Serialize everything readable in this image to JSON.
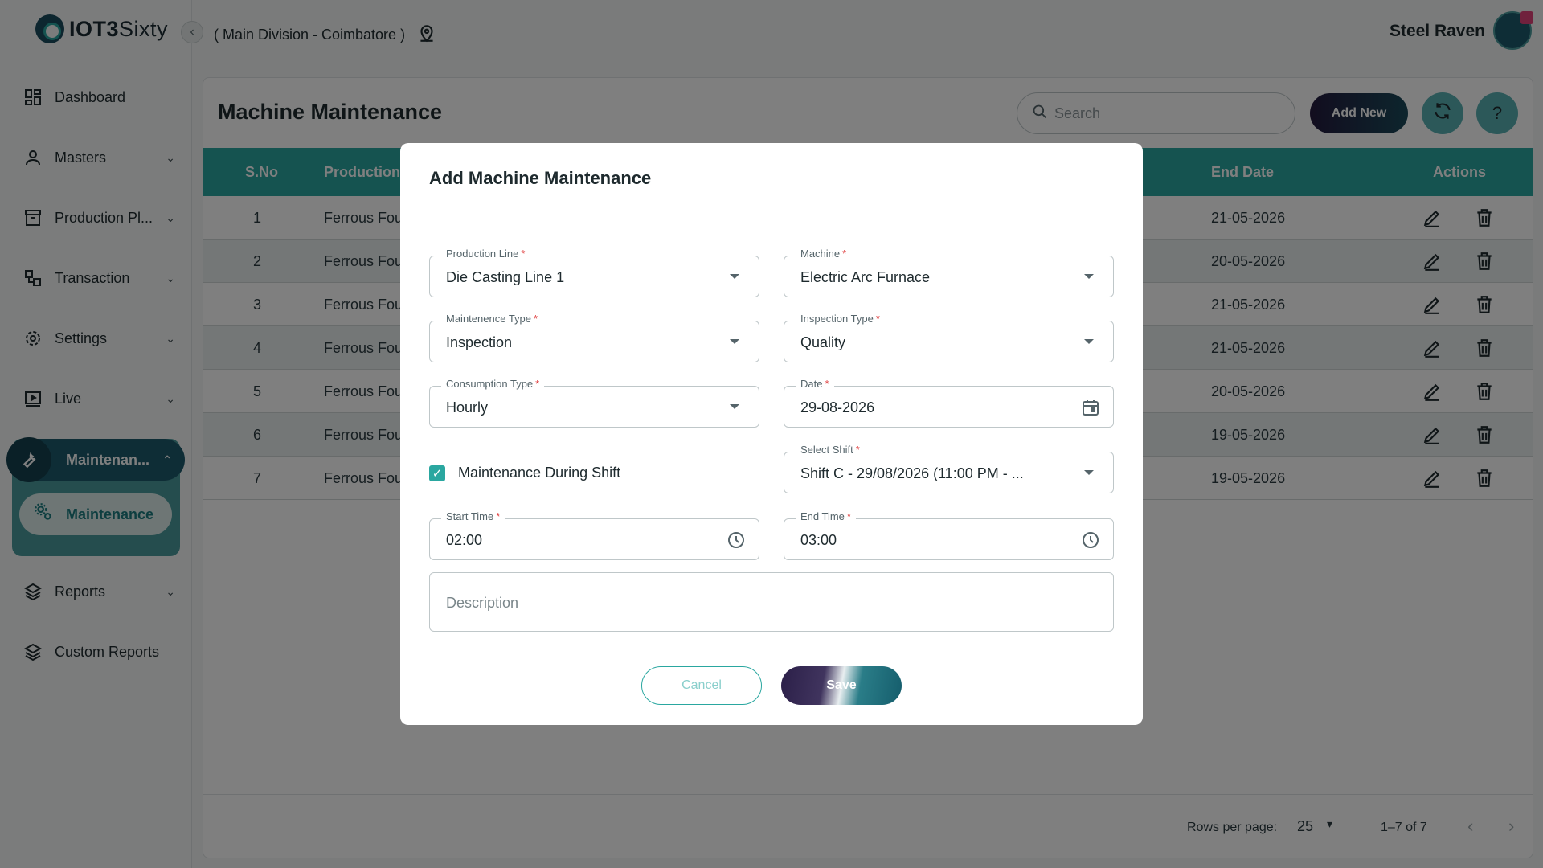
{
  "app": {
    "brand_bold": "IOT3",
    "brand_light": "Sixty"
  },
  "header": {
    "division": "( Main Division - Coimbatore )",
    "user_name": "Steel Raven"
  },
  "sidebar": {
    "items": [
      {
        "label": "Dashboard"
      },
      {
        "label": "Masters"
      },
      {
        "label": "Production Pl..."
      },
      {
        "label": "Transaction"
      },
      {
        "label": "Settings"
      },
      {
        "label": "Live"
      },
      {
        "label": "Maintenan..."
      },
      {
        "label": "Maintenance"
      },
      {
        "label": "Reports"
      },
      {
        "label": "Custom Reports"
      }
    ]
  },
  "page": {
    "title": "Machine Maintenance",
    "search_placeholder": "Search",
    "add_new_label": "Add New"
  },
  "table": {
    "columns": {
      "sno": "S.No",
      "production": "Production",
      "end_date": "End Date",
      "actions": "Actions"
    },
    "rows": [
      {
        "sno": "1",
        "production": "Ferrous Fou",
        "end_date": "21-05-2026"
      },
      {
        "sno": "2",
        "production": "Ferrous Fou",
        "end_date": "20-05-2026"
      },
      {
        "sno": "3",
        "production": "Ferrous Fou",
        "end_date": "21-05-2026"
      },
      {
        "sno": "4",
        "production": "Ferrous Fou",
        "end_date": "21-05-2026"
      },
      {
        "sno": "5",
        "production": "Ferrous Fou",
        "end_date": "20-05-2026"
      },
      {
        "sno": "6",
        "production": "Ferrous Fou",
        "end_date": "19-05-2026"
      },
      {
        "sno": "7",
        "production": "Ferrous Fou",
        "end_date": "19-05-2026"
      }
    ]
  },
  "pagination": {
    "rows_per_page_label": "Rows per page:",
    "rows_per_page": "25",
    "range": "1–7 of 7"
  },
  "modal": {
    "title": "Add Machine Maintenance",
    "production_line": {
      "label": "Production Line",
      "value": "Die Casting Line 1"
    },
    "machine": {
      "label": "Machine",
      "value": "Electric Arc Furnace"
    },
    "maintenance_type": {
      "label": "Maintenence Type",
      "value": "Inspection"
    },
    "inspection_type": {
      "label": "Inspection Type",
      "value": "Quality"
    },
    "consumption_type": {
      "label": "Consumption Type",
      "value": "Hourly"
    },
    "date": {
      "label": "Date",
      "value": "29-08-2026"
    },
    "maintenance_during_shift": {
      "label": "Maintenance During Shift",
      "checked": true
    },
    "select_shift": {
      "label": "Select Shift",
      "value": "Shift C - 29/08/2026 (11:00 PM - ..."
    },
    "start_time": {
      "label": "Start Time",
      "value": "02:00"
    },
    "end_time": {
      "label": "End Time",
      "value": "03:00"
    },
    "description": {
      "placeholder": "Description"
    },
    "required_mark": "*",
    "cancel_label": "Cancel",
    "save_label": "Save"
  },
  "colors": {
    "accent": "#2aa7a0",
    "primary_dark": "#1c5a6c",
    "required": "#e04040"
  }
}
